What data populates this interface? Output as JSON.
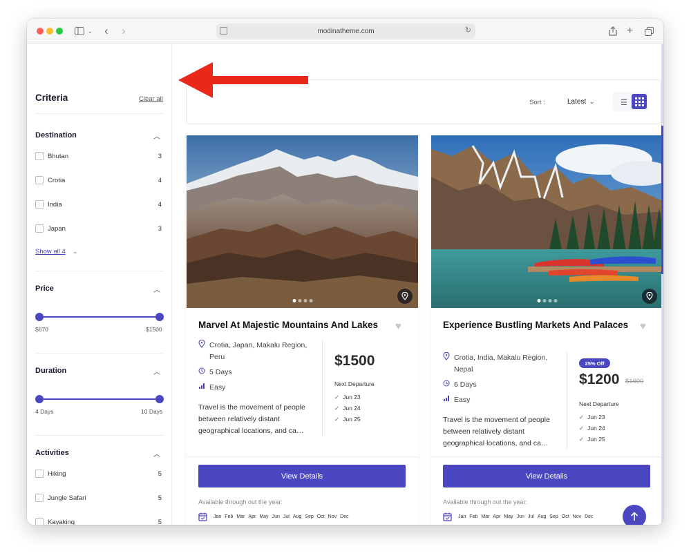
{
  "browser": {
    "url": "modinatheme.com"
  },
  "sidebar": {
    "title": "Criteria",
    "clear_all": "Clear all",
    "destination": {
      "title": "Destination",
      "items": [
        {
          "label": "Bhutan",
          "count": "3"
        },
        {
          "label": "Crotia",
          "count": "4"
        },
        {
          "label": "India",
          "count": "4"
        },
        {
          "label": "Japan",
          "count": "3"
        }
      ],
      "show_all": "Show all 4"
    },
    "price": {
      "title": "Price",
      "min": "$670",
      "max": "$1500"
    },
    "duration": {
      "title": "Duration",
      "min": "4 Days",
      "max": "10 Days"
    },
    "activities": {
      "title": "Activities",
      "items": [
        {
          "label": "Hiking",
          "count": "5"
        },
        {
          "label": "Jungle Safari",
          "count": "5"
        },
        {
          "label": "Kayaking",
          "count": "5"
        }
      ]
    }
  },
  "toolbar": {
    "sort_label": "Sort :",
    "sort_value": "Latest"
  },
  "cards": [
    {
      "title": "Marvel At Majestic Mountains And Lakes",
      "location": "Crotia, Japan, Makalu Region, Peru",
      "duration": "5 Days",
      "difficulty": "Easy",
      "description": "Travel is the movement of people between relatively distant geographical locations, and ca…",
      "price": "$1500",
      "next_departure_label": "Next Departure",
      "departures": [
        "Jun 23",
        "Jun 24",
        "Jun 25"
      ],
      "button": "View Details",
      "availability": "Available through out the year:",
      "months": [
        "Jan",
        "Feb",
        "Mar",
        "Apr",
        "May",
        "Jun",
        "Jul",
        "Aug",
        "Sep",
        "Oct",
        "Nov",
        "Dec"
      ]
    },
    {
      "title": "Experience Bustling Markets And Palaces",
      "location": "Crotia, India, Makalu Region, Nepal",
      "duration": "6 Days",
      "difficulty": "Easy",
      "description": "Travel is the movement of people between relatively distant geographical locations, and ca…",
      "badge": "25% Off",
      "price": "$1200",
      "old_price": "$1600",
      "next_departure_label": "Next Departure",
      "departures": [
        "Jun 23",
        "Jun 24",
        "Jun 25"
      ],
      "button": "View Details",
      "availability": "Available through out the year:",
      "months": [
        "Jan",
        "Feb",
        "Mar",
        "Apr",
        "May",
        "Jun",
        "Jul",
        "Aug",
        "Sep",
        "Oct",
        "Nov",
        "Dec"
      ]
    }
  ],
  "colors": {
    "accent": "#4b47c0",
    "annotation_arrow": "#e8281b"
  }
}
